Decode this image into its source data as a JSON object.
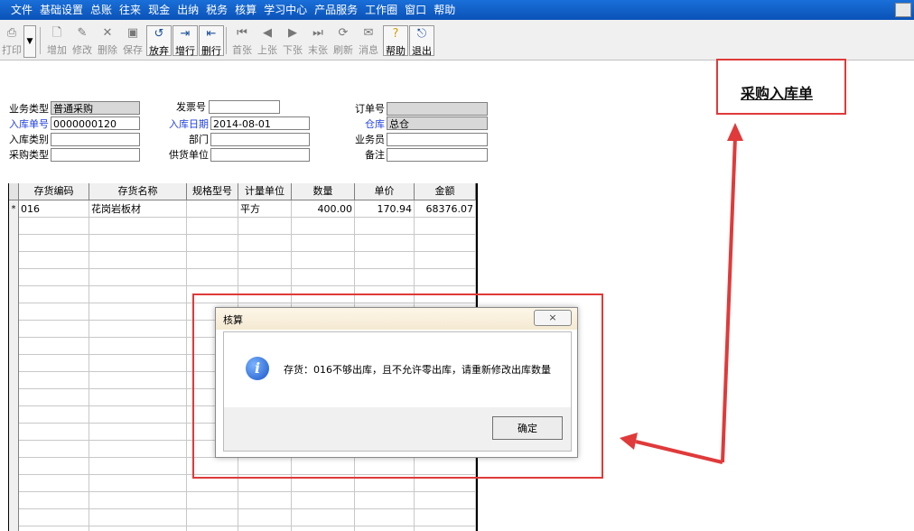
{
  "menu": [
    "文件",
    "基础设置",
    "总账",
    "往来",
    "现金",
    "出纳",
    "税务",
    "核算",
    "学习中心",
    "产品服务",
    "工作圈",
    "窗口",
    "帮助"
  ],
  "toolbar": {
    "print": "打印",
    "add": "增加",
    "edit": "修改",
    "delete": "删除",
    "save": "保存",
    "discard": "放弃",
    "add_row": "增行",
    "delete_row": "删行",
    "first": "首张",
    "prev": "上张",
    "next": "下张",
    "last": "末张",
    "refresh": "刷新",
    "message": "消息",
    "help": "帮助",
    "exit": "退出"
  },
  "document_title": "采购入库单",
  "form": {
    "business_type_label": "业务类型",
    "business_type_value": "普通采购",
    "invoice_no_label": "发票号",
    "invoice_no_value": "",
    "order_no_label": "订单号",
    "order_no_value": "",
    "receipt_no_label": "入库单号",
    "receipt_no_value": "0000000120",
    "receipt_date_label": "入库日期",
    "receipt_date_value": "2014-08-01",
    "warehouse_label": "仓库",
    "warehouse_value": "总仓",
    "receipt_category_label": "入库类别",
    "receipt_category_value": "",
    "department_label": "部门",
    "department_value": "",
    "salesperson_label": "业务员",
    "salesperson_value": "",
    "purchase_type_label": "采购类型",
    "purchase_type_value": "",
    "supplier_label": "供货单位",
    "supplier_value": "",
    "remark_label": "备注",
    "remark_value": ""
  },
  "table": {
    "columns": [
      "存货编码",
      "存货名称",
      "规格型号",
      "计量单位",
      "数量",
      "单价",
      "金额"
    ],
    "rows": [
      {
        "marker": "*",
        "code": "016",
        "name": "花岗岩板材",
        "spec": "",
        "unit": "平方",
        "qty": "400.00",
        "price": "170.94",
        "amount": "68376.07"
      }
    ]
  },
  "dialog": {
    "title": "核算",
    "close": "×",
    "message": "存货：016不够出库，且不允许零出库，请重新修改出库数量",
    "ok": "确定",
    "icon": "info-icon"
  },
  "colors": {
    "menubar": "#0a52b8",
    "highlight_border": "#e03a3a",
    "label_blue": "#2040e0"
  }
}
